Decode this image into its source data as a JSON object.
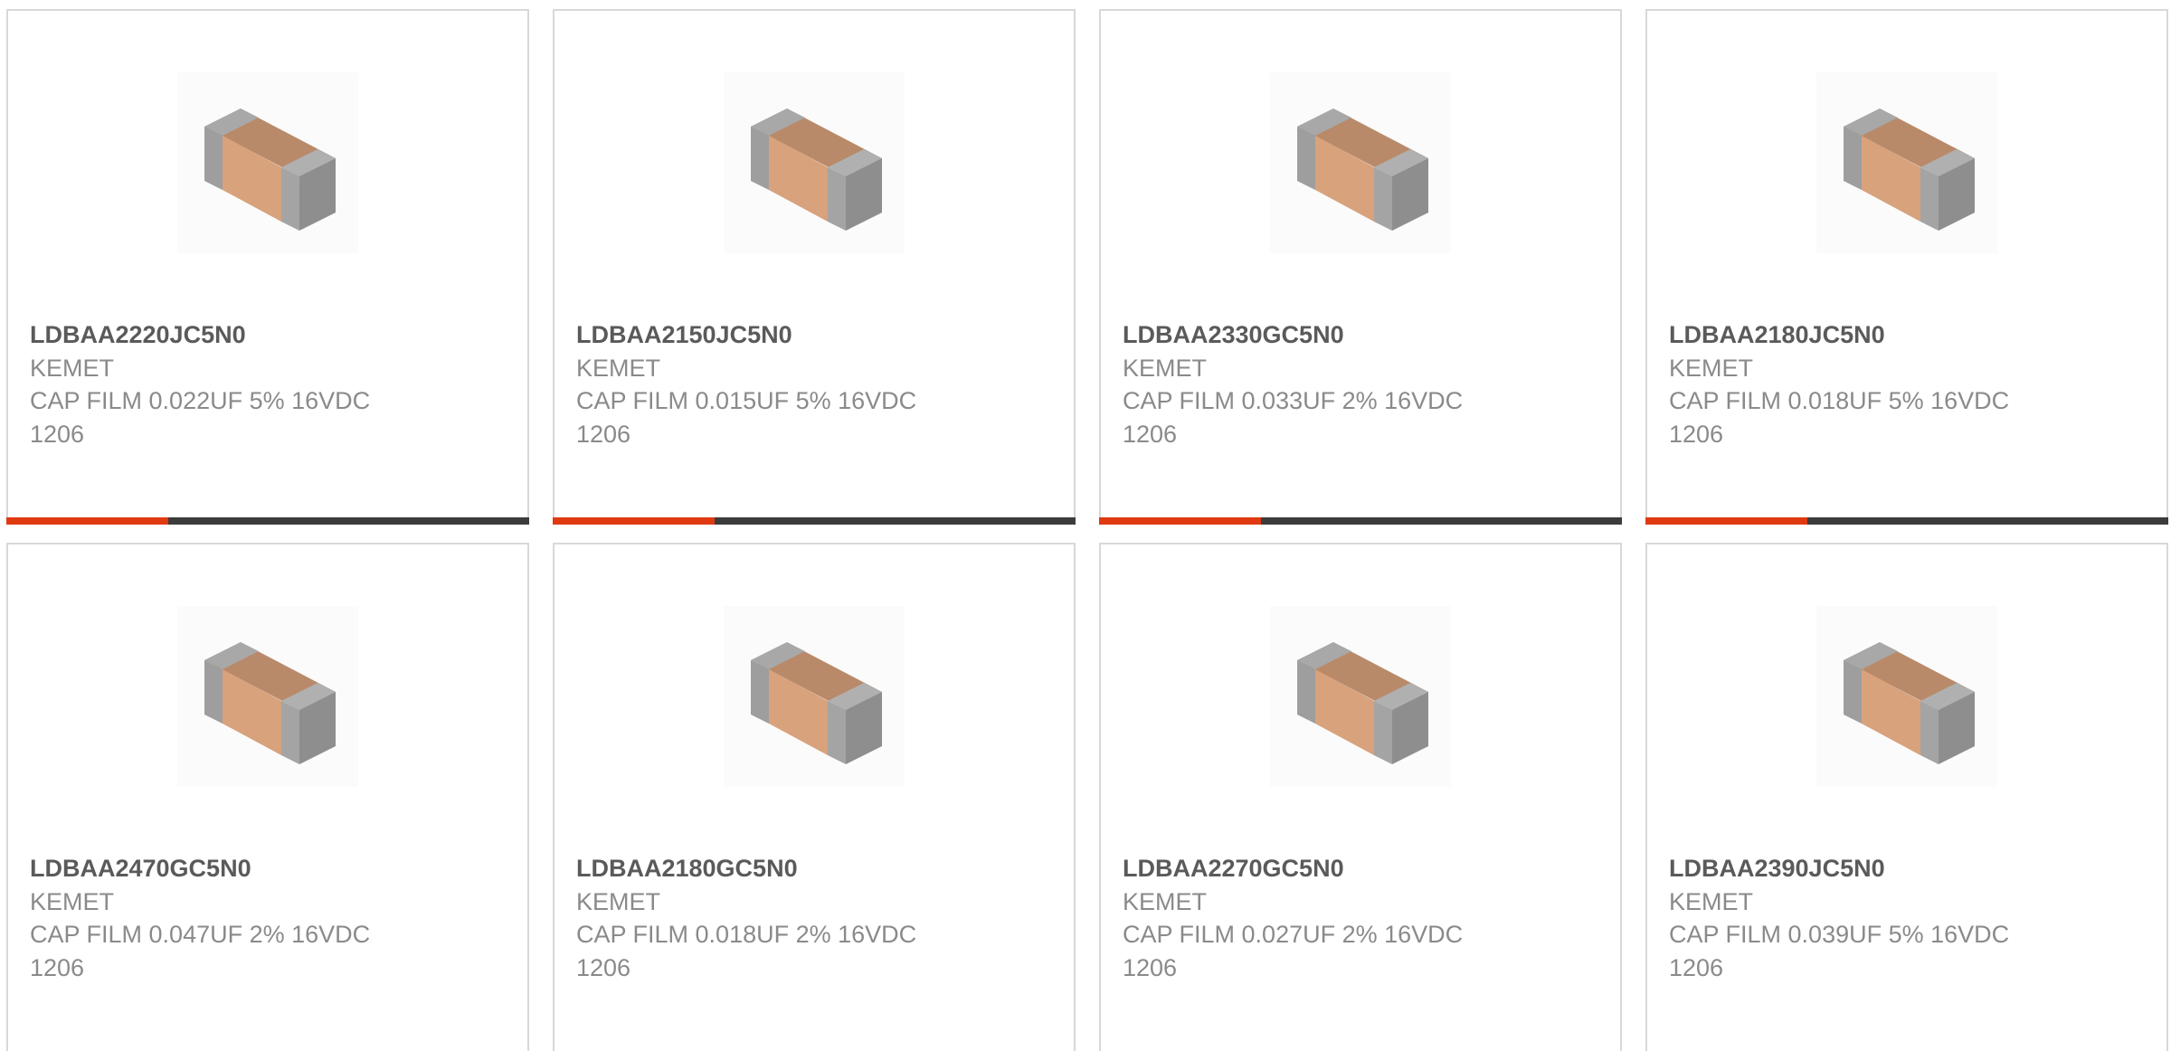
{
  "products": [
    {
      "part": "LDBAA2220JC5N0",
      "maker": "KEMET",
      "desc1": "CAP FILM 0.022UF 5% 16VDC",
      "desc2": "1206",
      "progress": 0.31,
      "icon": "capacitor-chip-image"
    },
    {
      "part": "LDBAA2150JC5N0",
      "maker": "KEMET",
      "desc1": "CAP FILM 0.015UF 5% 16VDC",
      "desc2": "1206",
      "progress": 0.31,
      "icon": "capacitor-chip-image"
    },
    {
      "part": "LDBAA2330GC5N0",
      "maker": "KEMET",
      "desc1": "CAP FILM 0.033UF 2% 16VDC",
      "desc2": "1206",
      "progress": 0.31,
      "icon": "capacitor-chip-image"
    },
    {
      "part": "LDBAA2180JC5N0",
      "maker": "KEMET",
      "desc1": "CAP FILM 0.018UF 5% 16VDC",
      "desc2": "1206",
      "progress": 0.31,
      "icon": "capacitor-chip-image"
    },
    {
      "part": "LDBAA2470GC5N0",
      "maker": "KEMET",
      "desc1": "CAP FILM 0.047UF 2% 16VDC",
      "desc2": "1206",
      "icon": "capacitor-chip-image"
    },
    {
      "part": "LDBAA2180GC5N0",
      "maker": "KEMET",
      "desc1": "CAP FILM 0.018UF 2% 16VDC",
      "desc2": "1206",
      "icon": "capacitor-chip-image"
    },
    {
      "part": "LDBAA2270GC5N0",
      "maker": "KEMET",
      "desc1": "CAP FILM 0.027UF 2% 16VDC",
      "desc2": "1206",
      "icon": "capacitor-chip-image"
    },
    {
      "part": "LDBAA2390JC5N0",
      "maker": "KEMET",
      "desc1": "CAP FILM 0.039UF 5% 16VDC",
      "desc2": "1206",
      "icon": "capacitor-chip-image"
    }
  ],
  "colors": {
    "accent": "#e03a12",
    "bar_track": "#3c3c3c",
    "border": "#d8d8d8",
    "part_text": "#5a5a5a",
    "body_text": "#8a8a8a"
  }
}
